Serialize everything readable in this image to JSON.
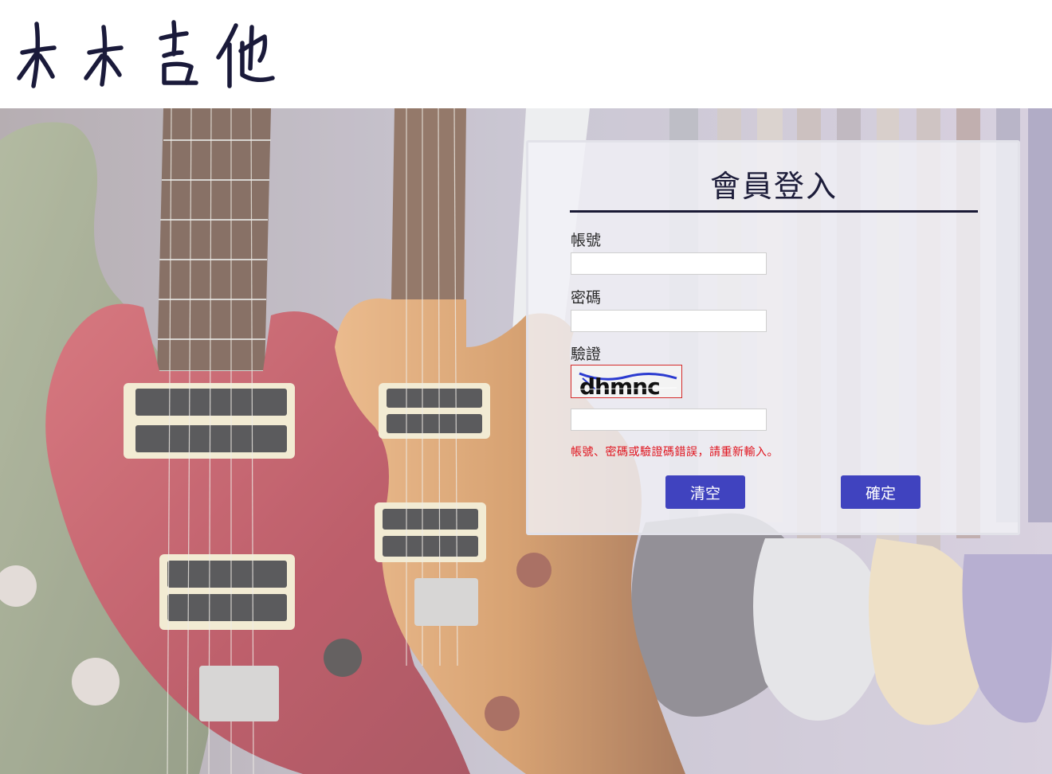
{
  "brand": {
    "logo_text": "木木吉他",
    "logo_icon": "calligraphy-logo",
    "color": "#1a1a3a"
  },
  "login": {
    "title": "會員登入",
    "account_label": "帳號",
    "account_value": "",
    "password_label": "密碼",
    "password_value": "",
    "captcha_label": "驗證",
    "captcha_text": "dhmnc",
    "captcha_value": "",
    "error_message": "帳號、密碼或驗證碼錯誤，請重新輸入。",
    "clear_button": "清空",
    "submit_button": "確定"
  },
  "colors": {
    "button": "#4043bf",
    "error": "#e0141e",
    "title_rule": "#1a1a35"
  }
}
